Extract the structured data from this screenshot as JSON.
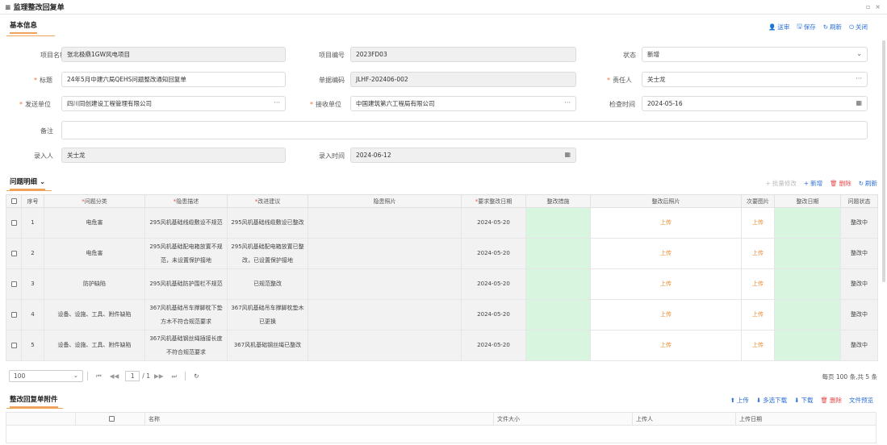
{
  "window": {
    "title": "≡ 监理整改回复单",
    "controls": [
      "▫",
      "×"
    ]
  },
  "basic": {
    "section_title": "基本信息"
  },
  "topbar": {
    "send": "送审",
    "save": "保存",
    "refresh": "刷新",
    "close": "关闭"
  },
  "form": {
    "project_name_label": "项目名称",
    "project_name": "张北极鼎1GW风电项目",
    "project_no_label": "项目编号",
    "project_no": "2023FD03",
    "status_label": "状态",
    "status": "新增",
    "title_label": "标题",
    "title": "24年5月中建六局QEHS问题整改通知回复单",
    "doc_no_label": "单据编码",
    "doc_no": "JLHF-202406-002",
    "owner_label": "责任人",
    "owner": "关士龙",
    "sender_label": "发送单位",
    "sender": "四川同创建设工程管理有限公司",
    "receiver_label": "接收单位",
    "receiver": "中国建筑第六工程局有限公司",
    "check_time_label": "检查时间",
    "check_time": "2024-05-16",
    "remark_label": "备注",
    "remark": "",
    "entered_by_label": "录入人",
    "entered_by": "关士龙",
    "entered_time_label": "录入时间",
    "entered_time": "2024-06-12",
    "ellipsis": "···",
    "calendar": "▦",
    "chevron": "⌄"
  },
  "issues": {
    "section_title": "问题明细 ⌄",
    "toolbar": {
      "batch_edit": "批量修改",
      "add": "新增",
      "delete": "删除",
      "refresh": "刷新"
    },
    "columns": [
      "序号",
      "问题分类",
      "隐患描述",
      "改进建议",
      "隐患照片",
      "要求整改日期",
      "整改措施",
      "整改后照片",
      "次要图片",
      "整改日期",
      "问题状态"
    ],
    "required_cols": [
      "问题分类",
      "隐患描述",
      "改进建议",
      "要求整改日期"
    ],
    "rows": [
      {
        "no": "1",
        "category": "电危害",
        "desc": "295风机基础线缆敷设不规范",
        "advice": "295风机基础线缆敷设已整改",
        "due": "2024-05-20",
        "after": "上传",
        "secondary": "上传",
        "state": "整改中"
      },
      {
        "no": "2",
        "category": "电危害",
        "desc": "295风机基础配电箱放置不规范，未设置保护接地",
        "advice": "295风机基础配电箱放置已整改，已设置保护接地",
        "due": "2024-05-20",
        "after": "上传",
        "secondary": "上传",
        "state": "整改中"
      },
      {
        "no": "3",
        "category": "防护缺陷",
        "desc": "295风机基础防护围栏不规范",
        "advice": "已规范整改",
        "due": "2024-05-20",
        "after": "上传",
        "secondary": "上传",
        "state": "整改中"
      },
      {
        "no": "4",
        "category": "设备、设施、工具、附件缺陷",
        "desc": "367风机基础吊车撑脚枕下垫方木不符合规范要求",
        "advice": "367风机基础吊车撑脚枕垫木已更换",
        "due": "2024-05-20",
        "after": "上传",
        "secondary": "上传",
        "state": "整改中"
      },
      {
        "no": "5",
        "category": "设备、设施、工具、附件缺陷",
        "desc": "367风机基础钢丝绳插接长度不符合规范要求",
        "advice": "367风机基础钢丝绳已整改",
        "due": "2024-05-20",
        "after": "上传",
        "secondary": "上传",
        "state": "整改中"
      }
    ],
    "pager": {
      "page_size": "100",
      "page": "1",
      "total_pages": "/ 1",
      "summary": "每页 100 条,共 5 条"
    }
  },
  "attachments": {
    "section_title": "整改回复单附件",
    "toolbar": {
      "upload": "上传",
      "multi_download": "多选下载",
      "download": "下载",
      "delete": "删除",
      "preview": "文件预览"
    },
    "columns": [
      "名称",
      "文件大小",
      "上传人",
      "上传日期"
    ]
  },
  "colors": {
    "accent": "#f0a35b",
    "link": "#2a6fd6",
    "danger": "#e54a4a",
    "green_cell": "#d7f5df",
    "upload": "#f08a2c"
  }
}
